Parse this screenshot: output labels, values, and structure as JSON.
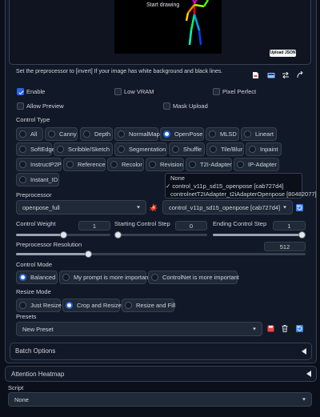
{
  "preview": {
    "status": "Start drawing",
    "upload_json": "Upload JSON"
  },
  "hint": "Set the preprocessor to [invert] If your image has white background and black lines.",
  "options": {
    "enable": "Enable",
    "low_vram": "Low VRAM",
    "pixel_perfect": "Pixel Perfect",
    "allow_preview": "Allow Preview",
    "mask_upload": "Mask Upload"
  },
  "control_type": {
    "label": "Control Type",
    "selected": "OpenPose",
    "items": [
      "All",
      "Canny",
      "Depth",
      "NormalMap",
      "OpenPose",
      "MLSD",
      "Lineart",
      "SoftEdge",
      "Scribble/Sketch",
      "Segmentation",
      "Shuffle",
      "Tile/Blur",
      "Inpaint",
      "InstructP2P",
      "Reference",
      "Recolor",
      "Revision",
      "T2I-Adapter",
      "IP-Adapter",
      "Instant_ID"
    ]
  },
  "preprocessor": {
    "label": "Preprocessor",
    "value": "openpose_full"
  },
  "model": {
    "value": "control_v11p_sd15_openpose [cab727d4]",
    "options": [
      "None",
      "control_v11p_sd15_openpose [cab727d4]",
      "controlnetT2IAdapter_t2iAdapterOpenpose [80482077]"
    ],
    "selected_index": 1
  },
  "sliders": {
    "control_weight": {
      "label": "Control Weight",
      "value": "1",
      "fraction": 0.5
    },
    "starting_step": {
      "label": "Starting Control Step",
      "value": "0",
      "fraction": 0.0
    },
    "ending_step": {
      "label": "Ending Control Step",
      "value": "1",
      "fraction": 1.0
    },
    "resolution": {
      "label": "Preprocessor Resolution",
      "value": "512",
      "fraction": 0.25
    }
  },
  "control_mode": {
    "label": "Control Mode",
    "items": [
      "Balanced",
      "My prompt is more important",
      "ControlNet is more important"
    ],
    "selected": "Balanced"
  },
  "resize_mode": {
    "label": "Resize Mode",
    "items": [
      "Just Resize",
      "Crop and Resize",
      "Resize and Fill"
    ],
    "selected": "Crop and Resize"
  },
  "presets": {
    "label": "Presets",
    "value": "New Preset"
  },
  "batch_options": "Batch Options",
  "attention_heatmap": "Attention Heatmap",
  "script": {
    "label": "Script",
    "value": "None"
  }
}
